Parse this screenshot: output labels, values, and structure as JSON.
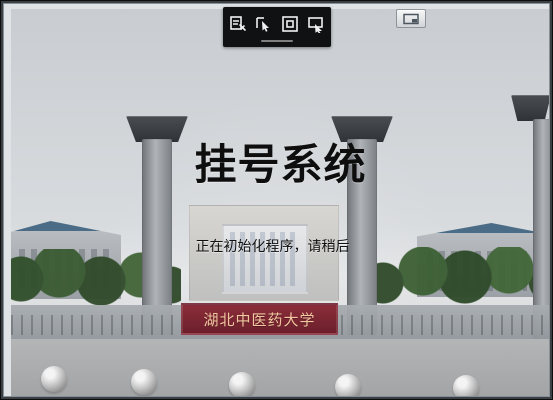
{
  "app": {
    "title": "挂号系统",
    "status": "正在初始化程序，请稍后"
  },
  "background": {
    "sign_text": "湖北中医药大学"
  },
  "toolbar": {
    "icons": [
      "document-edit-icon",
      "pointer-select-icon",
      "frame-icon",
      "screen-pointer-icon"
    ]
  },
  "top_right": {
    "icon": "screen-icon"
  }
}
